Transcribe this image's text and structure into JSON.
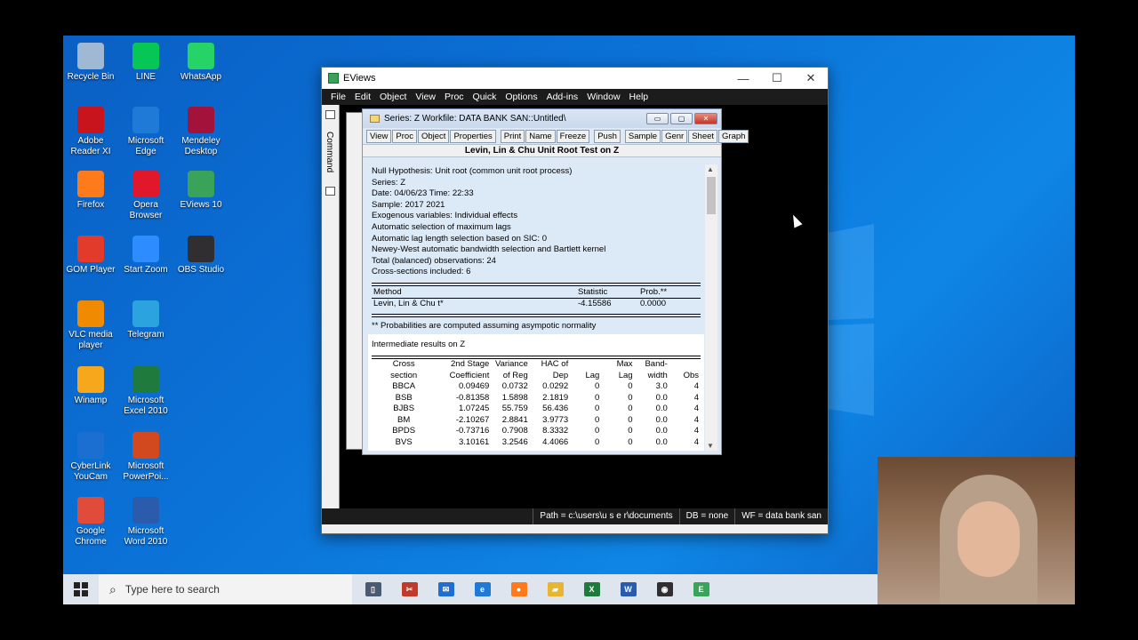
{
  "desktop": {
    "icons": [
      {
        "label": "Recycle Bin",
        "icon": "recycle-bin-icon",
        "color": "#9fb8d4"
      },
      {
        "label": "LINE",
        "icon": "line-icon",
        "color": "#06c755"
      },
      {
        "label": "WhatsApp",
        "icon": "whatsapp-icon",
        "color": "#25d366"
      },
      {
        "label": "Adobe Reader XI",
        "icon": "adobe-reader-icon",
        "color": "#c8141c"
      },
      {
        "label": "Microsoft Edge",
        "icon": "edge-icon",
        "color": "#1e7ad6"
      },
      {
        "label": "Mendeley Desktop",
        "icon": "mendeley-icon",
        "color": "#a3123a"
      },
      {
        "label": "Firefox",
        "icon": "firefox-icon",
        "color": "#ff7a1a"
      },
      {
        "label": "Opera Browser",
        "icon": "opera-icon",
        "color": "#e1172b"
      },
      {
        "label": "EViews 10",
        "icon": "eviews-icon",
        "color": "#3aa35a"
      },
      {
        "label": "GOM Player",
        "icon": "gom-player-icon",
        "color": "#e33b2b"
      },
      {
        "label": "Start Zoom",
        "icon": "zoom-icon",
        "color": "#2d8cff"
      },
      {
        "label": "OBS Studio",
        "icon": "obs-icon",
        "color": "#302e31"
      },
      {
        "label": "VLC media player",
        "icon": "vlc-icon",
        "color": "#f08a00"
      },
      {
        "label": "Telegram",
        "icon": "telegram-icon",
        "color": "#2aa3df"
      },
      {
        "label": "Winamp",
        "icon": "winamp-icon",
        "color": "#f6a71b"
      },
      {
        "label": "Microsoft Excel 2010",
        "icon": "excel-icon",
        "color": "#1f7a3e"
      },
      {
        "label": "CyberLink YouCam",
        "icon": "youcam-icon",
        "color": "#1a6fd1"
      },
      {
        "label": "Microsoft PowerPoi...",
        "icon": "powerpoint-icon",
        "color": "#d2481f"
      },
      {
        "label": "Google Chrome",
        "icon": "chrome-icon",
        "color": "#e04b3a"
      },
      {
        "label": "Microsoft Word 2010",
        "icon": "word-icon",
        "color": "#2b5bad"
      }
    ]
  },
  "eviews": {
    "title": "EViews",
    "menu": [
      "File",
      "Edit",
      "Object",
      "View",
      "Proc",
      "Quick",
      "Options",
      "Add-ins",
      "Window",
      "Help"
    ],
    "command_label": "Command",
    "status": {
      "path": "Path = c:\\users\\u s e r\\documents",
      "db": "DB = none",
      "wf": "WF = data bank san"
    }
  },
  "series_window": {
    "title": "Series: Z   Workfile: DATA BANK SAN::Untitled\\",
    "toolbar": [
      "View",
      "Proc",
      "Object",
      "Properties",
      "Print",
      "Name",
      "Freeze",
      "Push",
      "Sample",
      "Genr",
      "Sheet",
      "Graph"
    ],
    "heading": "Levin, Lin & Chu Unit Root Test on Z",
    "info_lines": [
      "Null Hypothesis: Unit root (common unit root process)",
      "Series:  Z",
      "Date: 04/06/23   Time: 22:33",
      "Sample: 2017 2021",
      "Exogenous variables: Individual effects",
      "Automatic selection of maximum lags",
      "Automatic lag length selection based on SIC: 0",
      "Newey-West automatic bandwidth selection and Bartlett kernel",
      "Total (balanced) observations: 24",
      "Cross-sections included: 6"
    ],
    "test_table": {
      "headers": [
        "Method",
        "Statistic",
        "Prob.**"
      ],
      "rows": [
        [
          "Levin, Lin & Chu t*",
          "-4.15586",
          "0.0000"
        ]
      ]
    },
    "note": "** Probabilities are computed assuming asympotic normality",
    "intermediate_title": "Intermediate results on Z",
    "intermediate": {
      "headers1": [
        "Cross",
        "2nd Stage",
        "Variance",
        "HAC of",
        "",
        "Max",
        "Band-",
        ""
      ],
      "headers2": [
        "section",
        "Coefficient",
        "of Reg",
        "Dep",
        "Lag",
        "Lag",
        "width",
        "Obs"
      ],
      "rows": [
        [
          "BBCA",
          "0.09469",
          "0.0732",
          "0.0292",
          "0",
          "0",
          "3.0",
          "4"
        ],
        [
          "BSB",
          "-0.81358",
          "1.5898",
          "2.1819",
          "0",
          "0",
          "0.0",
          "4"
        ],
        [
          "BJBS",
          "1.07245",
          "55.759",
          "56.436",
          "0",
          "0",
          "0.0",
          "4"
        ],
        [
          "BM",
          "-2.10267",
          "2.8841",
          "3.9773",
          "0",
          "0",
          "0.0",
          "4"
        ],
        [
          "BPDS",
          "-0.73716",
          "0.7908",
          "8.3332",
          "0",
          "0",
          "0.0",
          "4"
        ],
        [
          "BVS",
          "3.10161",
          "3.2546",
          "4.4066",
          "0",
          "0",
          "0.0",
          "4"
        ]
      ]
    }
  },
  "taskbar": {
    "search_placeholder": "Type here to search",
    "apps": [
      {
        "name": "task-view-icon",
        "color": "#4a5a70",
        "glyph": "▯"
      },
      {
        "name": "snip-icon",
        "color": "#c0392b",
        "glyph": "✂"
      },
      {
        "name": "mail-icon",
        "color": "#1e6fd1",
        "glyph": "✉"
      },
      {
        "name": "edge-icon",
        "color": "#1e7ad6",
        "glyph": "e"
      },
      {
        "name": "firefox-icon",
        "color": "#ff7a1a",
        "glyph": "●"
      },
      {
        "name": "file-explorer-icon",
        "color": "#e8b530",
        "glyph": "▰"
      },
      {
        "name": "excel-icon",
        "color": "#1f7a3e",
        "glyph": "X"
      },
      {
        "name": "word-icon",
        "color": "#2b5bad",
        "glyph": "W"
      },
      {
        "name": "obs-icon",
        "color": "#302e31",
        "glyph": "◉"
      },
      {
        "name": "eviews-icon",
        "color": "#3aa35a",
        "glyph": "E"
      }
    ]
  }
}
